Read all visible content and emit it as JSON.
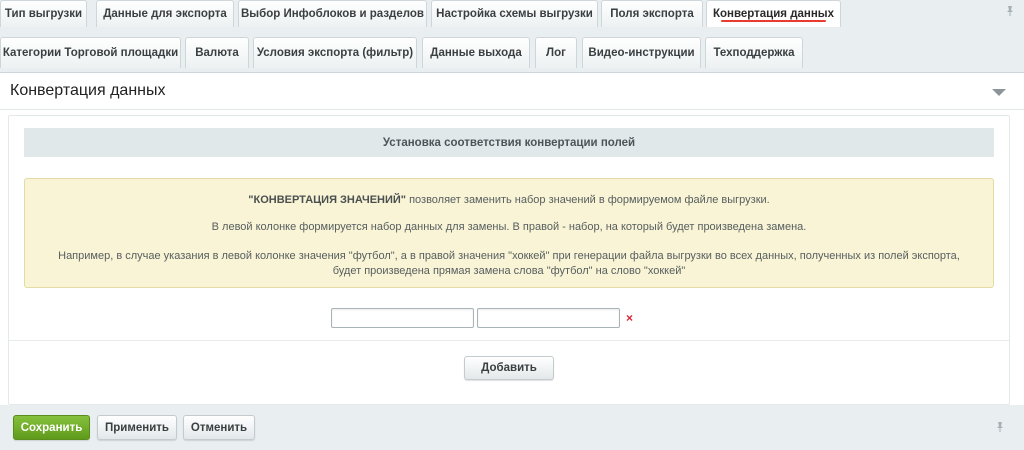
{
  "tabs_row1": [
    {
      "label": "Тип выгрузки"
    },
    {
      "label": "Данные для экспорта"
    },
    {
      "label": "Выбор Инфоблоков и разделов"
    },
    {
      "label": "Настройка схемы выгрузки"
    },
    {
      "label": "Поля экспорта"
    },
    {
      "label": "Конвертация данных",
      "active": true
    }
  ],
  "tabs_row2": [
    {
      "label": "Категории Торговой площадки"
    },
    {
      "label": "Валюта"
    },
    {
      "label": "Условия экспорта (фильтр)"
    },
    {
      "label": "Данные выхода"
    },
    {
      "label": "Лог"
    },
    {
      "label": "Видео-инструкции"
    },
    {
      "label": "Техподдержка"
    }
  ],
  "panel": {
    "title": "Конвертация данных",
    "section_header": "Установка соответствия конвертации полей",
    "notice": {
      "p1_bold": "\"КОНВЕРТАЦИЯ ЗНАЧЕНИЙ\"",
      "p1_rest": " позволяет заменить набор значений в формируемом файле выгрузки.",
      "p2": "В левой колонке формируется набор данных для замены. В правой - набор, на который будет произведена замена.",
      "p3": "Например, в случае указания в левой колонке значения \"футбол\", а в правой значения \"хоккей\" при генерации файла выгрузки во всех данных, полученных из полей экспорта, будет произведена прямая замена слова \"футбол\" на слово \"хоккей\""
    },
    "row": {
      "from_value": "",
      "to_value": "",
      "delete_glyph": "×"
    },
    "add_label": "Добавить"
  },
  "footer": {
    "save_label": "Сохранить",
    "apply_label": "Применить",
    "cancel_label": "Отменить"
  },
  "colors": {
    "accent_underline": "#e93c30",
    "save_button": "#6fa82a",
    "notice_bg": "#f8f4d5"
  },
  "icons": {
    "pin": "pin-icon",
    "collapse": "chevron-down-icon",
    "delete": "close-icon"
  }
}
